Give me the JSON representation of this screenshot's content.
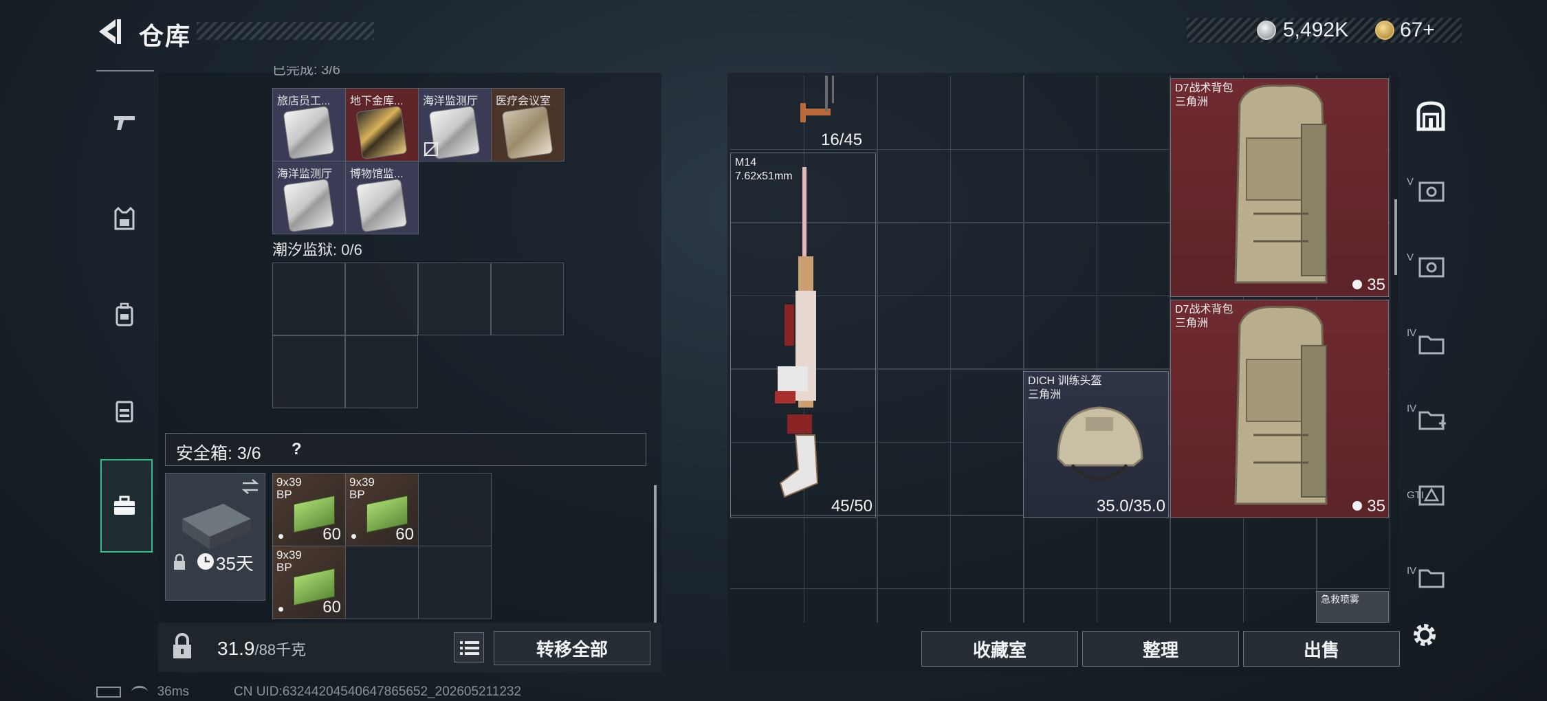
{
  "header": {
    "title": "仓库",
    "currency_silver": "5,492K",
    "currency_gold": "67+"
  },
  "left_panel": {
    "keycard_cut_label": "已完成: 3/6",
    "keycards": [
      {
        "label": "旅店员工..."
      },
      {
        "label": "地下金库..."
      },
      {
        "label": "海洋监测厅"
      },
      {
        "label": "医疗会议室"
      },
      {
        "label": "海洋监测厅"
      },
      {
        "label": "博物馆监..."
      }
    ],
    "tidal_prison_label": "潮汐监狱: 0/6",
    "safe_box_label": "安全箱: 3/6",
    "safe_box_help": "?",
    "safe_box_days": "35天",
    "ammo": [
      {
        "label_1": "9x39",
        "label_2": "BP",
        "count": "60"
      },
      {
        "label_1": "9x39",
        "label_2": "BP",
        "count": "60"
      },
      {
        "label_1": "9x39",
        "label_2": "BP",
        "count": "60"
      }
    ],
    "weight_current": "31.9",
    "weight_max": "/88千克",
    "transfer_all": "转移全部"
  },
  "right_panel": {
    "top_item_count": "16/45",
    "rifle": {
      "name": "M14",
      "caliber": "7.62x51mm",
      "count": "45/50"
    },
    "helmet": {
      "name": "DICH 训练头盔",
      "origin": "三角洲",
      "durability": "35.0/35.0"
    },
    "backpacks": [
      {
        "name": "D7战术背包",
        "origin": "三角洲",
        "count": "35"
      },
      {
        "name": "D7战术背包",
        "origin": "三角洲",
        "count": "35"
      }
    ],
    "partial_item_label": "急救喷雾"
  },
  "right_tabs": [
    {
      "roman": "V"
    },
    {
      "roman": "V"
    },
    {
      "roman": "IV"
    },
    {
      "roman": "IV"
    },
    {
      "roman": "GTI"
    },
    {
      "roman": "IV"
    }
  ],
  "bottom_buttons": {
    "collection": "收藏室",
    "sort": "整理",
    "sell": "出售"
  },
  "status": {
    "ping": "36ms",
    "uid": "CN UID:632442045406478656​52_202605211232"
  },
  "colors": {
    "accent_green": "#2fbf8f",
    "rare_red": "#6e2a30",
    "common_blue": "#2e3446"
  }
}
